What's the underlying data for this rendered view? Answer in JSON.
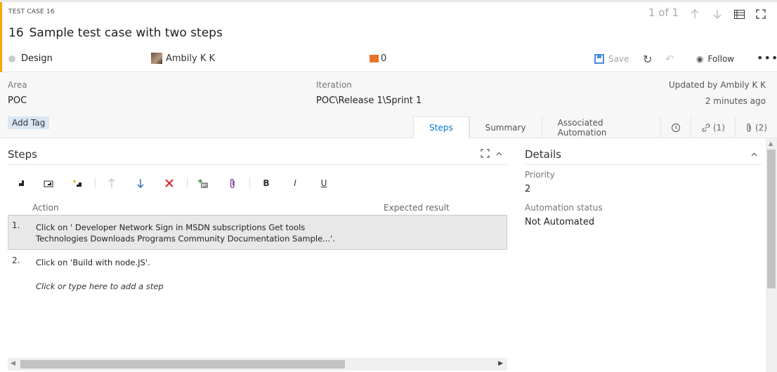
{
  "header": {
    "type_label": "TEST CASE 16",
    "id": "16",
    "title": "Sample test case with two steps",
    "pager": "1 of 1",
    "state": "Design",
    "assignee": "Ambily K K",
    "comment_count": "0",
    "save_label": "Save",
    "follow_label": "Follow",
    "more_label": "•••"
  },
  "info": {
    "area_label": "Area",
    "area_value": "POC",
    "iteration_label": "Iteration",
    "iteration_value": "POC\\Release 1\\Sprint 1",
    "updated_by": "Updated by Ambily K K",
    "updated_time": "2 minutes ago",
    "add_tag_label": "Add Tag"
  },
  "tabs": {
    "steps": "Steps",
    "summary": "Summary",
    "associated_automation": "Associated Automation",
    "links": "(1)",
    "attachments": "(2)"
  },
  "steps": {
    "title": "Steps",
    "col_action": "Action",
    "col_expected": "Expected result",
    "rows": [
      {
        "num": "1.",
        "line1": "Click on  '  Developer Network Sign in MSDN subscriptions  Get tools",
        "line2": "Technologies Downloads Programs Community Documentation Sample...'."
      },
      {
        "num": "2.",
        "line1": "Click on  'Build with node.JS'."
      }
    ],
    "add_step_hint": "Click or type here to add a step"
  },
  "toolbar": {
    "bold": "B",
    "italic": "I",
    "underline": "U"
  },
  "details": {
    "title": "Details",
    "priority_label": "Priority",
    "priority_value": "2",
    "automation_label": "Automation status",
    "automation_value": "Not Automated"
  },
  "colors": {
    "accent": "#f2a900",
    "link_blue": "#0078d4",
    "comment_orange": "#e8742a",
    "delete_red": "#d9262c"
  }
}
